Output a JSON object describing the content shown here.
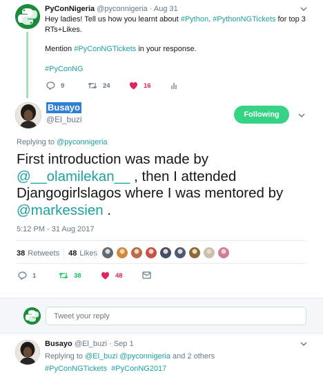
{
  "parent_tweet": {
    "name": "PyConNigeria",
    "handle": "@pyconnigeria",
    "date": "· Aug 31",
    "text_prefix": "Hey ladies! Tell us how you learnt about ",
    "tag_python": "#Python",
    "text_mid": ". ",
    "tag_tickets": "#PythonNGTickets",
    "text_suffix": " for top 3 RTs+Likes.",
    "mention_prefix": "Mention ",
    "tag_pycontickets": "#PyConNGTickets",
    "mention_suffix": " in your response.",
    "tag_pyconng": "#PyConNG",
    "replies": "9",
    "retweets": "24",
    "likes": "16"
  },
  "focus_tweet": {
    "name": "Busayo",
    "handle": "@El_buzi",
    "follow_label": "Following",
    "replying_prefix": "Replying to ",
    "replying_to": "@pyconnigeria",
    "text_1": "First introduction was made by ",
    "mention_1": "@__olamilekan__",
    "text_2": " , then I attended Djangogirlslagos where I was mentored by ",
    "mention_2": "@markessien",
    "text_3": " .",
    "timestamp": "5:12 PM - 31 Aug 2017",
    "retweet_count": "38",
    "retweet_label": "Retweets",
    "like_count": "48",
    "like_label": "Likes",
    "liker_colors": [
      "#5a6b7c",
      "#d08a3a",
      "#b86a4a",
      "#c94f4f",
      "#3f4f6a",
      "#4a5a7a",
      "#8a6a3a",
      "#c8c0b0",
      "#d27aa0"
    ],
    "replies": "1",
    "retweets": "38",
    "likes": "48"
  },
  "composer": {
    "placeholder": "Tweet your reply"
  },
  "reply_tweet": {
    "name": "Busayo",
    "handle": "@El_buzi",
    "date": "· Sep 1",
    "replying_prefix": "Replying to ",
    "replying_to_1": "@El_buzi",
    "replying_to_2": "@pyconnigeria",
    "replying_suffix": " and 2 others",
    "tag_1": "#PyConNGTickets",
    "tag_2": "#PyConNG2017"
  },
  "colors": {
    "accent_green": "#17bf63",
    "link_teal": "#1da1a0",
    "like_pink": "#e0245e",
    "follow_button": "#37d384",
    "muted": "#657786"
  }
}
